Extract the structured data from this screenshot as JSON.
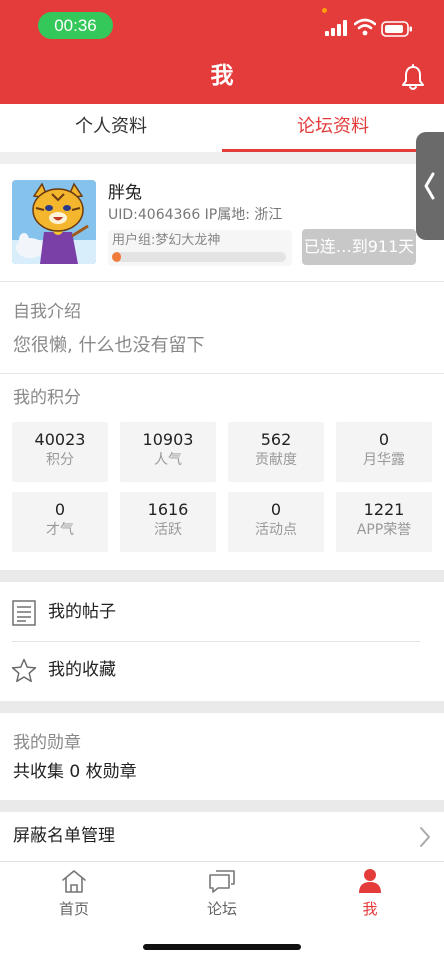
{
  "status_bar": {
    "time": "00:36"
  },
  "header": {
    "title": "我"
  },
  "tabs": [
    {
      "label": "个人资料",
      "active": false
    },
    {
      "label": "论坛资料",
      "active": true
    }
  ],
  "profile": {
    "name": "胖兔",
    "uid_line": "UID:4064366  IP属地: 浙江",
    "user_group": "用户组:梦幻大龙神",
    "level_progress": 0.05,
    "sign_button": "已连…到911天"
  },
  "intro": {
    "title": "自我介绍",
    "text": "您很懒, 什么也没有留下"
  },
  "points": {
    "title": "我的积分",
    "stats": [
      {
        "value": "40023",
        "label": "积分"
      },
      {
        "value": "10903",
        "label": "人气"
      },
      {
        "value": "562",
        "label": "贡献度"
      },
      {
        "value": "0",
        "label": "月华露"
      },
      {
        "value": "0",
        "label": "才气"
      },
      {
        "value": "1616",
        "label": "活跃"
      },
      {
        "value": "0",
        "label": "活动点"
      },
      {
        "value": "1221",
        "label": "APP荣誉"
      }
    ]
  },
  "links": {
    "my_posts": "我的帖子",
    "my_favorites": "我的收藏"
  },
  "medals": {
    "title": "我的勋章",
    "summary": "共收集 0 枚勋章"
  },
  "blocklist": {
    "label": "屏蔽名单管理"
  },
  "bottom_nav": [
    {
      "label": "首页",
      "icon": "home-icon",
      "active": false
    },
    {
      "label": "论坛",
      "icon": "chat-bubble-icon",
      "active": false
    },
    {
      "label": "我",
      "icon": "person-icon",
      "active": true
    }
  ],
  "colors": {
    "brand_red": "#e43b3b",
    "status_green": "#34c759",
    "progress_orange": "#f07a3a"
  }
}
